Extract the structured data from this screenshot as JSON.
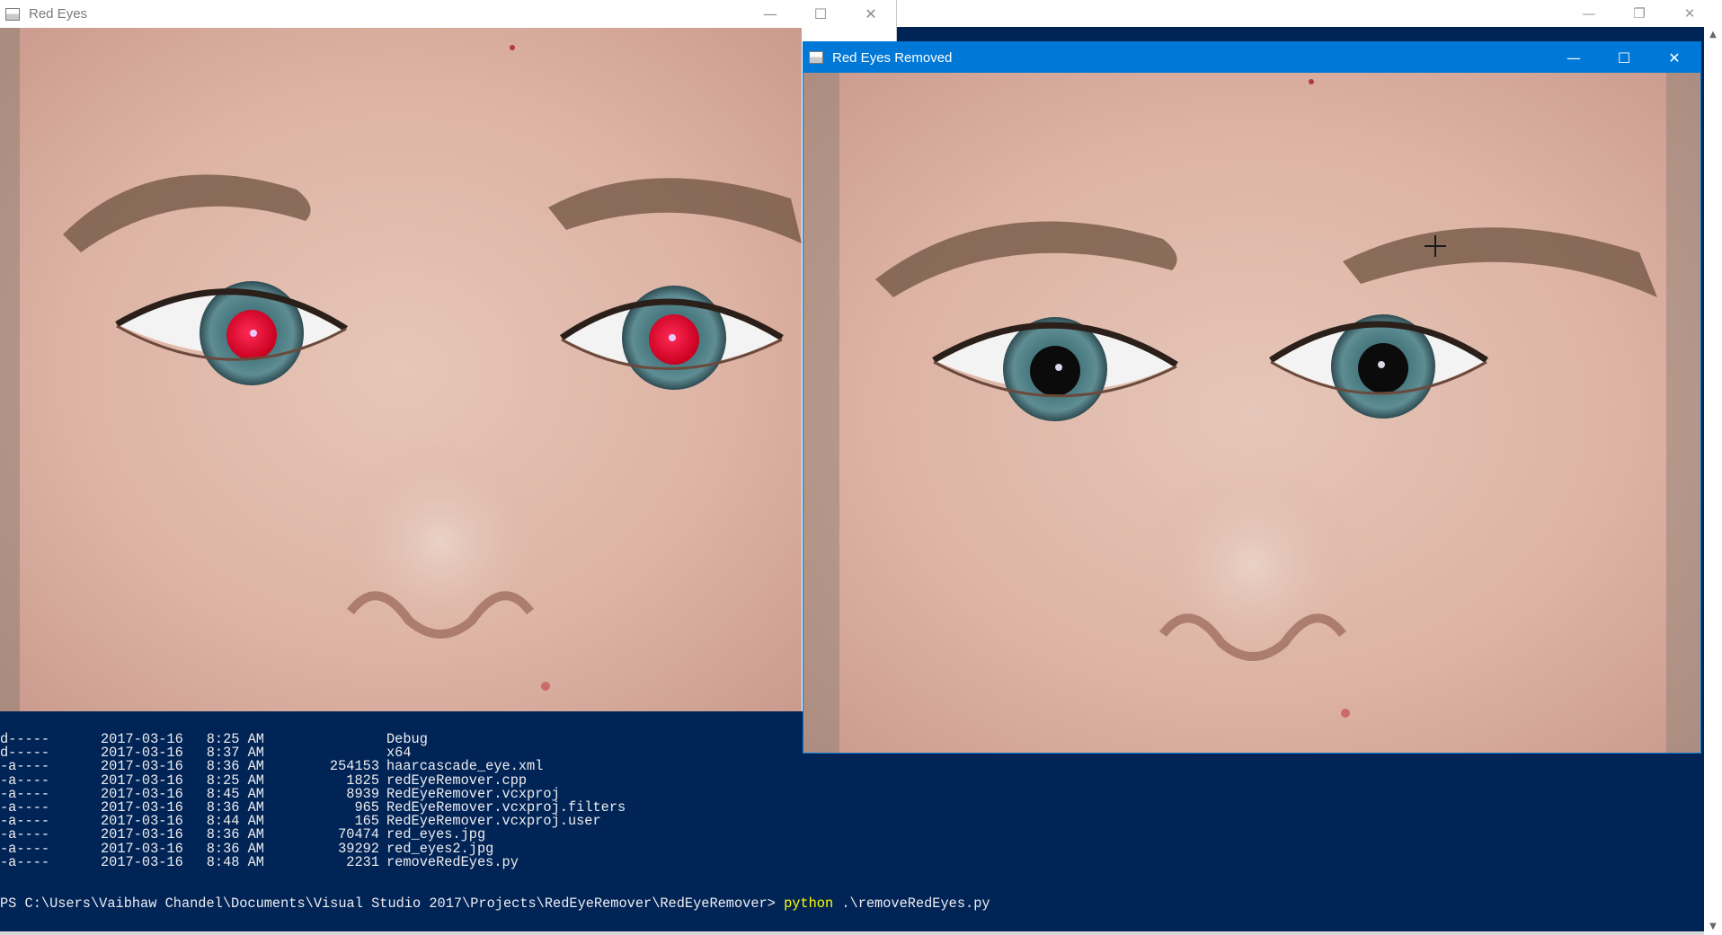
{
  "console": {
    "listing": [
      {
        "mode": "d-----",
        "date": "2017-03-16",
        "time": "8:25 AM",
        "length": "",
        "name": "Debug"
      },
      {
        "mode": "d-----",
        "date": "2017-03-16",
        "time": "8:37 AM",
        "length": "",
        "name": "x64"
      },
      {
        "mode": "-a----",
        "date": "2017-03-16",
        "time": "8:36 AM",
        "length": "254153",
        "name": "haarcascade_eye.xml"
      },
      {
        "mode": "-a----",
        "date": "2017-03-16",
        "time": "8:25 AM",
        "length": "1825",
        "name": "redEyeRemover.cpp"
      },
      {
        "mode": "-a----",
        "date": "2017-03-16",
        "time": "8:45 AM",
        "length": "8939",
        "name": "RedEyeRemover.vcxproj"
      },
      {
        "mode": "-a----",
        "date": "2017-03-16",
        "time": "8:36 AM",
        "length": "965",
        "name": "RedEyeRemover.vcxproj.filters"
      },
      {
        "mode": "-a----",
        "date": "2017-03-16",
        "time": "8:44 AM",
        "length": "165",
        "name": "RedEyeRemover.vcxproj.user"
      },
      {
        "mode": "-a----",
        "date": "2017-03-16",
        "time": "8:36 AM",
        "length": "70474",
        "name": "red_eyes.jpg"
      },
      {
        "mode": "-a----",
        "date": "2017-03-16",
        "time": "8:36 AM",
        "length": "39292",
        "name": "red_eyes2.jpg"
      },
      {
        "mode": "-a----",
        "date": "2017-03-16",
        "time": "8:48 AM",
        "length": "2231",
        "name": "removeRedEyes.py"
      }
    ],
    "prompt": "PS C:\\Users\\Vaibhaw Chandel\\Documents\\Visual Studio 2017\\Projects\\RedEyeRemover\\RedEyeRemover> ",
    "command": "python",
    "args": " .\\removeRedEyes.py"
  },
  "window_red": {
    "title": "Red Eyes",
    "image": "face-photo-red-eyes",
    "pupil_color": "#e3002a"
  },
  "window_fixed": {
    "title": "Red Eyes Removed",
    "image": "face-photo-red-eyes-removed",
    "pupil_color": "#0b0b0b"
  },
  "caption_buttons": {
    "minimize": "—",
    "maximize": "☐",
    "restore": "❐",
    "close": "✕"
  },
  "colors": {
    "console_bg": "#012456",
    "console_text": "#eeedf0",
    "command_text": "#ffff00",
    "active_titlebar": "#0078d7"
  }
}
